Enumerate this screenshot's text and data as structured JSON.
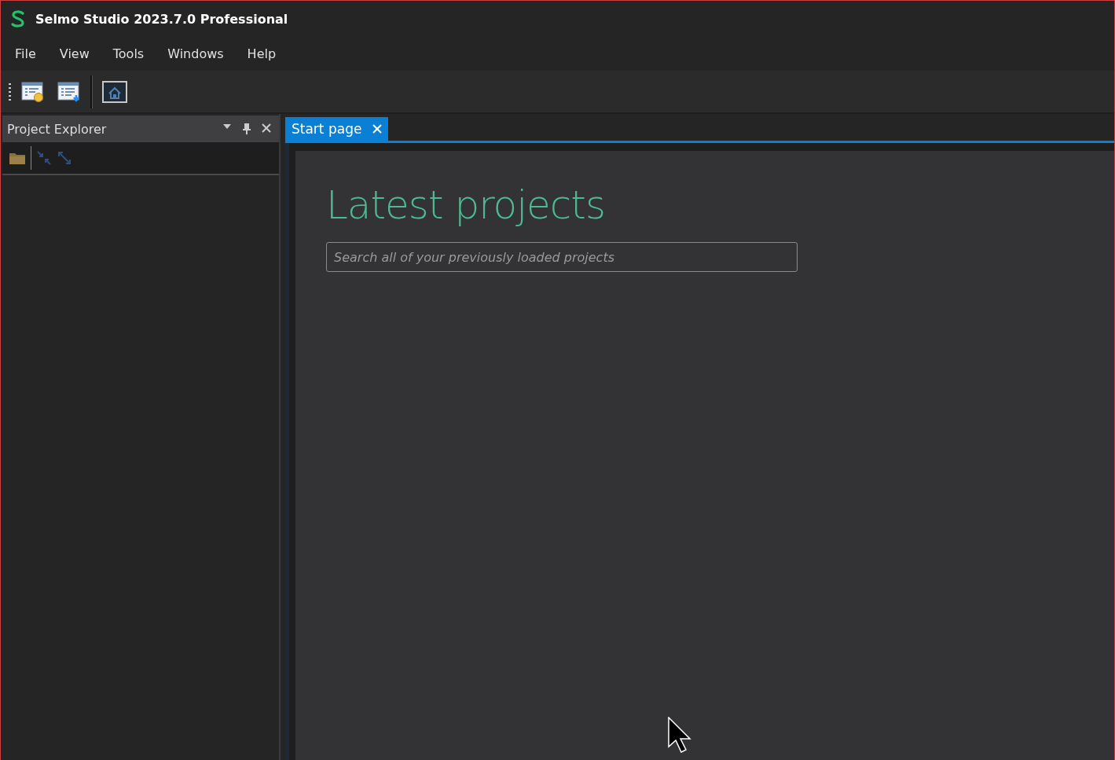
{
  "window": {
    "title": "Selmo Studio 2023.7.0 Professional"
  },
  "menu": [
    "File",
    "View",
    "Tools",
    "Windows",
    "Help"
  ],
  "project_explorer": {
    "title": "Project Explorer"
  },
  "tabs": [
    {
      "label": "Start page",
      "selected": true
    }
  ],
  "start_page": {
    "heading": "Latest projects",
    "search": {
      "placeholder": "Search all of your previously loaded projects"
    }
  }
}
